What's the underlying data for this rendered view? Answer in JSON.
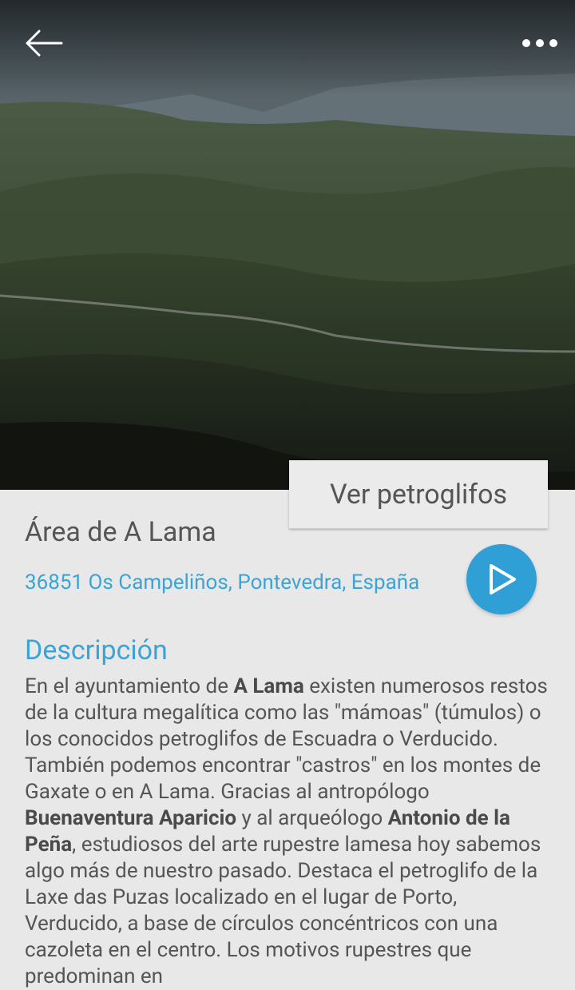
{
  "header": {
    "back_icon": "arrow-left-icon",
    "more_icon": "more-horizontal-icon"
  },
  "hero": {
    "image": "mountain-landscape-photo"
  },
  "actions": {
    "ver_petroglifos_label": "Ver petroglifos",
    "play_icon": "play-icon"
  },
  "place": {
    "title": "Área de A Lama",
    "address": "36851 Os Campeliños, Pontevedra, España"
  },
  "description": {
    "heading": "Descripción",
    "p1": "En el ayuntamiento de ",
    "b1": "A Lama",
    "p2": " existen numerosos restos de la cultura megalítica como las \"mámoas\" (túmulos) o los conocidos petroglifos de Escuadra o Verducido. También podemos encontrar \"castros\" en los montes de Gaxate o en A Lama. Gracias al antropólogo ",
    "b2": "Buenaventura Aparicio",
    "p3": " y al arqueólogo ",
    "b3": "Antonio de la Peña",
    "p4": ", estudiosos del arte rupestre lamesa hoy sabemos algo más de nuestro pasado. Destaca el petroglifo de la Laxe das Puzas localizado en el lugar de Porto, Verducido, a base de círculos concéntricos con una cazoleta en el centro. Los motivos rupestres que predominan en"
  },
  "colors": {
    "accent": "#2f9fd5",
    "link": "#3ba3d6",
    "text": "#555555",
    "background": "#e8e8e8"
  }
}
